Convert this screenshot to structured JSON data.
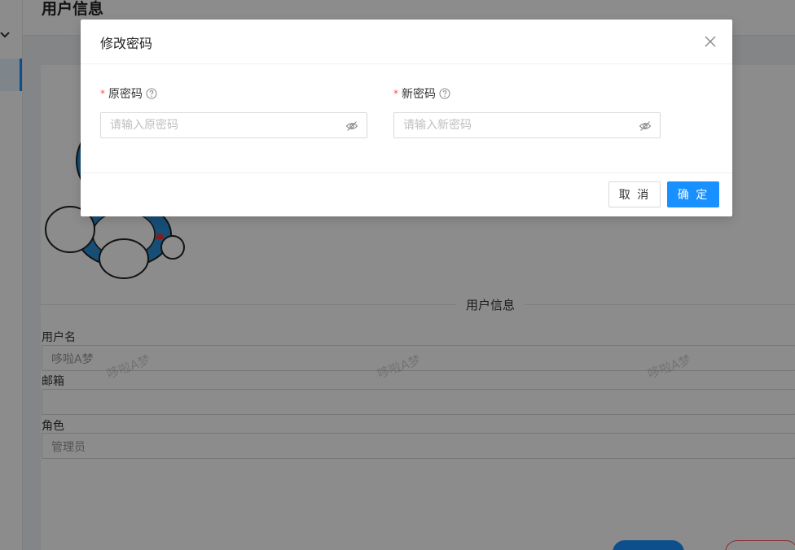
{
  "page": {
    "title": "用户信息"
  },
  "profile": {
    "section_title": "用户信息",
    "fields": [
      {
        "label": "用户名",
        "value": "哆啦A梦"
      },
      {
        "label": "邮箱",
        "value": ""
      },
      {
        "label": "角色",
        "value": "管理员"
      }
    ],
    "watermark": "哆啦A梦"
  },
  "modal": {
    "title": "修改密码",
    "old_password": {
      "label": "原密码",
      "placeholder": "请输入原密码"
    },
    "new_password": {
      "label": "新密码",
      "placeholder": "请输入新密码"
    },
    "cancel_label": "取 消",
    "ok_label": "确 定"
  },
  "colors": {
    "primary": "#1890ff",
    "required": "#ff4d4f",
    "mask": "rgba(0,0,0,0.45)"
  }
}
